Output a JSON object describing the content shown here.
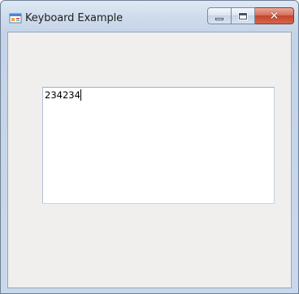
{
  "window": {
    "title": "Keyboard Example"
  },
  "icons": {
    "app": "app-icon",
    "minimize": "minimize-icon",
    "maximize": "maximize-icon",
    "close": "close-icon"
  },
  "textbox": {
    "value": "234234"
  },
  "colors": {
    "client_background": "#f0efee",
    "close_button": "#c4452c"
  }
}
